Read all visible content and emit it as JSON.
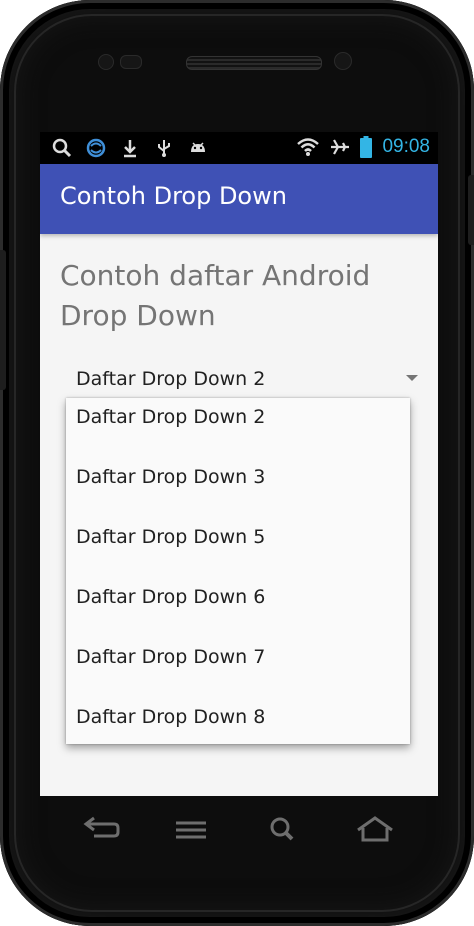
{
  "status_bar": {
    "left_icons": [
      "search-icon",
      "sync-icon",
      "download-icon",
      "usb-icon",
      "android-icon"
    ],
    "right_icons": [
      "wifi-icon",
      "airplane-icon",
      "battery-icon"
    ],
    "time": "09:08"
  },
  "app_bar": {
    "title": "Contoh Drop Down"
  },
  "content": {
    "heading": "Contoh daftar Android Drop Down"
  },
  "spinner": {
    "selected": "Daftar Drop Down 2"
  },
  "dropdown": {
    "items": [
      "Daftar Drop Down 2",
      "Daftar Drop Down 3",
      "Daftar Drop Down 5",
      "Daftar Drop Down 6",
      "Daftar Drop Down 7",
      "Daftar Drop Down 8"
    ]
  },
  "nav_bar": {
    "buttons": [
      "back-icon",
      "menu-icon",
      "search-icon",
      "home-icon"
    ]
  },
  "colors": {
    "app_bar": "#3f51b5",
    "time": "#33b5e5",
    "screen_bg": "#f5f5f5"
  }
}
